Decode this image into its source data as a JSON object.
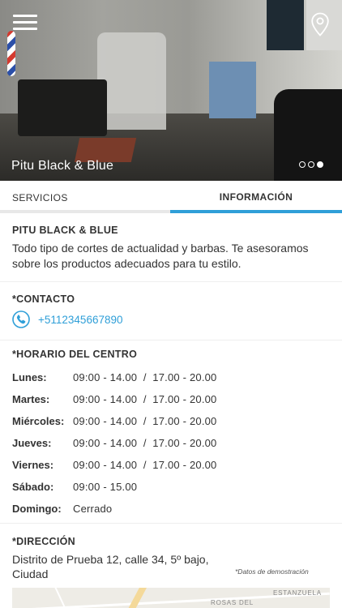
{
  "hero": {
    "title": "Pitu Black & Blue",
    "slides": 3,
    "active_slide": 3,
    "menu_icon": "hamburger-menu-icon",
    "location_icon": "map-pin-icon"
  },
  "tabs": [
    {
      "label": "SERVICIOS",
      "active": false
    },
    {
      "label": "INFORMACIÓN",
      "active": true
    }
  ],
  "about": {
    "title": "PITU BLACK & BLUE",
    "description_line1": "Todo tipo de cortes de actualidad y barbas. Te asesoramos",
    "description_line2": "sobre los productos adecuados para tu estilo."
  },
  "contact": {
    "title": "*CONTACTO",
    "phone": "+5112345667890",
    "phone_icon": "phone-icon"
  },
  "hours": {
    "title": "*HORARIO DEL CENTRO",
    "rows": [
      {
        "day": "Lunes:",
        "hours": "09:00 - 14.00  /  17.00 - 20.00"
      },
      {
        "day": "Martes:",
        "hours": "09:00 - 14.00  /  17.00 - 20.00"
      },
      {
        "day": "Miércoles:",
        "hours": "09:00 - 14.00  /  17.00 - 20.00"
      },
      {
        "day": "Jueves:",
        "hours": "09:00 - 14.00  /  17.00 - 20.00"
      },
      {
        "day": "Viernes:",
        "hours": "09:00 - 14.00  /  17.00 - 20.00"
      },
      {
        "day": "Sábado:",
        "hours": "09:00 - 15.00"
      },
      {
        "day": "Domingo:",
        "hours": "Cerrado"
      }
    ]
  },
  "address": {
    "title": "*DIRECCIÓN",
    "line1": "Distrito de Prueba 12, calle 34, 5º bajo,",
    "line2": "Ciudad",
    "demo_note": "*Datos de demostración",
    "map_labels": [
      "ESTANZUELA",
      "ROSAS DEL"
    ]
  },
  "colors": {
    "accent": "#2f9fd8",
    "text": "#333333"
  }
}
